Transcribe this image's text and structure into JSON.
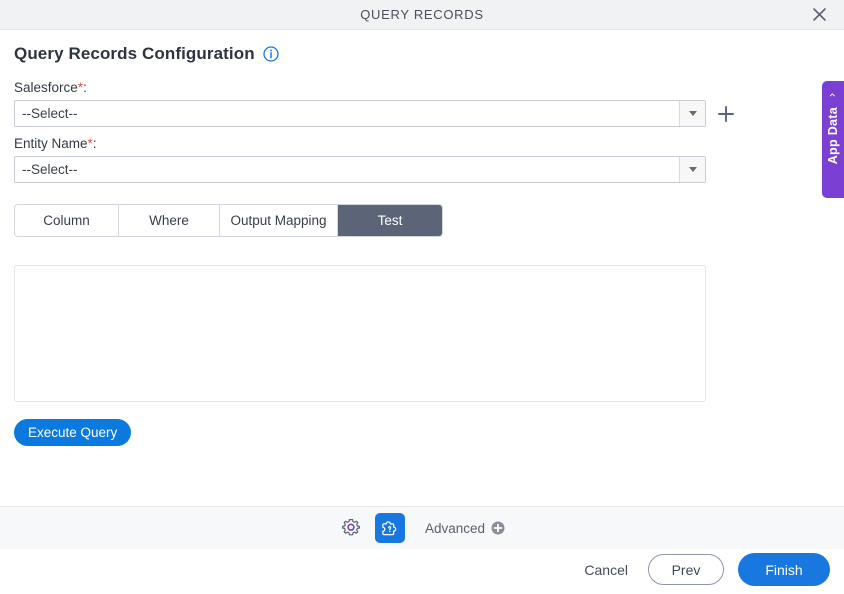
{
  "window": {
    "title": "QUERY RECORDS",
    "close_icon": "close-icon"
  },
  "page": {
    "heading": "Query Records Configuration",
    "info_icon": "info-icon"
  },
  "fields": [
    {
      "label": "Salesforce",
      "required_marker": "*",
      "colon": ":",
      "value": "--Select--",
      "has_add_button": true,
      "add_icon": "plus-icon"
    },
    {
      "label": "Entity Name",
      "required_marker": "*",
      "colon": ":",
      "value": "--Select--",
      "has_add_button": false
    }
  ],
  "tabs": [
    {
      "label": "Column",
      "active": false
    },
    {
      "label": "Where",
      "active": false
    },
    {
      "label": "Output Mapping",
      "active": false
    },
    {
      "label": "Test",
      "active": true
    }
  ],
  "test_panel": {
    "result_value": "",
    "result_placeholder": "",
    "execute_label": "Execute Query"
  },
  "app_data_tab": {
    "label": "App Data",
    "chevron_icon": "chevron-left-icon"
  },
  "toolbar": {
    "settings_icon": "gear-icon",
    "plugin_icon": "puzzle-question-icon",
    "advanced_label": "Advanced",
    "advanced_add_icon": "plus-circle-icon"
  },
  "actions": {
    "cancel_label": "Cancel",
    "prev_label": "Prev",
    "finish_label": "Finish"
  },
  "colors": {
    "accent_blue": "#1878e0",
    "execute_blue": "#0b7ae0",
    "active_tab_slate": "#5c6478",
    "app_data_purple": "#7b3fd4",
    "required_red": "#d9534f",
    "gear_purple": "#7b3fd4"
  }
}
